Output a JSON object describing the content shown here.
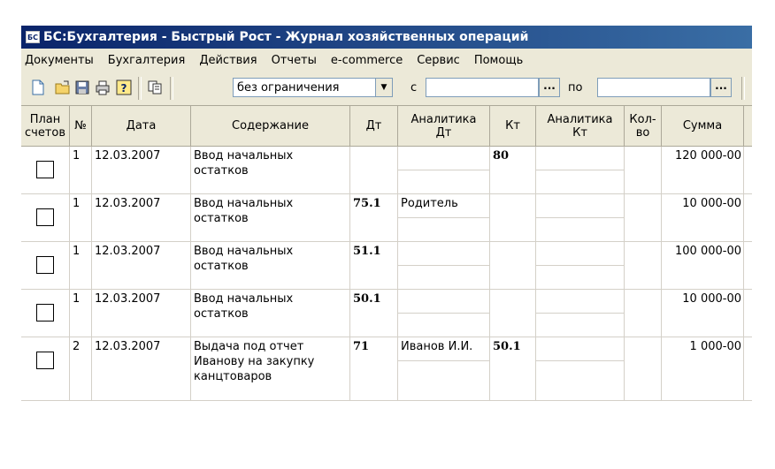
{
  "window": {
    "title": "БС:Бухгалтерия - Быстрый Рост - Журнал хозяйственных операций"
  },
  "menu": [
    "Документы",
    "Бухгалтерия",
    "Действия",
    "Отчеты",
    "e-commerce",
    "Сервис",
    "Помощь"
  ],
  "toolbar": {
    "icons": [
      "new-document-icon",
      "open-folder-icon",
      "save-icon",
      "print-icon",
      "help-icon",
      "copy-icon"
    ],
    "period_filter": "без ограничения",
    "from_label": "с",
    "to_label": "по",
    "dots": "..."
  },
  "table": {
    "headers": {
      "plan": "План\nсчетов",
      "num": "№",
      "date": "Дата",
      "content": "Содержание",
      "dt": "Дт",
      "an_dt": "Аналитика\nДт",
      "kt": "Кт",
      "an_kt": "Аналитика\nКт",
      "qty": "Кол-\nво",
      "sum": "Сумма"
    },
    "rows": [
      {
        "num": "1",
        "date": "12.03.2007",
        "content": "Ввод начальных\nостатков",
        "dt": "",
        "an_dt": "",
        "kt": "80",
        "an_kt": "",
        "qty": "",
        "sum": "120 000-00"
      },
      {
        "num": "1",
        "date": "12.03.2007",
        "content": "Ввод начальных\nостатков",
        "dt": "75.1",
        "an_dt": "Родитель",
        "kt": "",
        "an_kt": "",
        "qty": "",
        "sum": "10 000-00"
      },
      {
        "num": "1",
        "date": "12.03.2007",
        "content": "Ввод начальных\nостатков",
        "dt": "51.1",
        "an_dt": "",
        "kt": "",
        "an_kt": "",
        "qty": "",
        "sum": "100 000-00"
      },
      {
        "num": "1",
        "date": "12.03.2007",
        "content": "Ввод начальных\nостатков",
        "dt": "50.1",
        "an_dt": "",
        "kt": "",
        "an_kt": "",
        "qty": "",
        "sum": "10 000-00"
      },
      {
        "num": "2",
        "date": "12.03.2007",
        "content": "Выдача под отчет\nИванову на закупку\nканцтоваров",
        "dt": "71",
        "an_dt": "Иванов И.И.",
        "kt": "50.1",
        "an_kt": "",
        "qty": "",
        "sum": "1 000-00"
      }
    ]
  }
}
